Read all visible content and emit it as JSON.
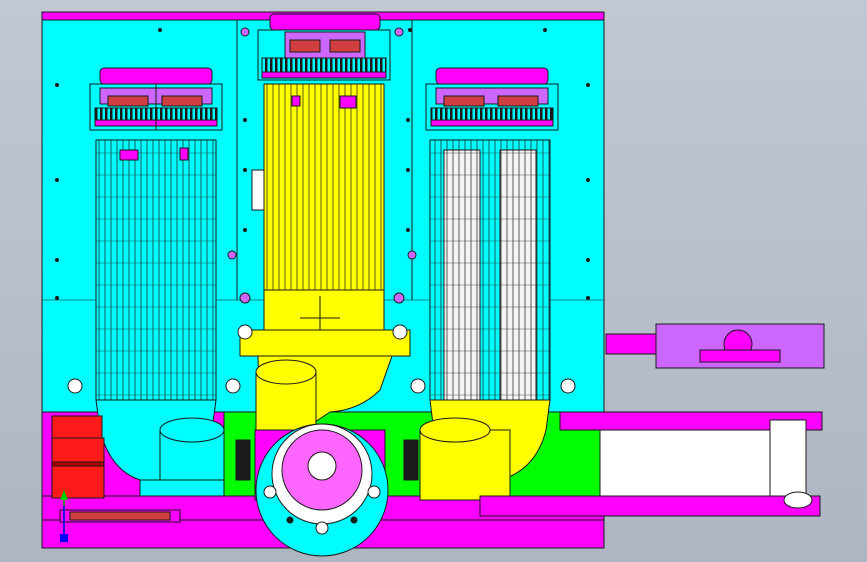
{
  "viewport": {
    "background_top": "#c2c8d2",
    "background_bottom": "#aeb6c4"
  },
  "colors": {
    "frame_cyan": "#00fdfd",
    "frame_magenta": "#ff00ff",
    "housing_yellow": "#ffff00",
    "base_green": "#00ff00",
    "motor_white": "#f4f4f4",
    "motor_red": "#ff1a1a",
    "roller_white": "#ffffff",
    "gear_violet": "#cc66ff",
    "outline": "#1a1a1a"
  },
  "components": [
    {
      "name": "left-motor",
      "color": "cyan"
    },
    {
      "name": "center-motor",
      "color": "yellow"
    },
    {
      "name": "right-motor",
      "color": "white"
    },
    {
      "name": "red-motor",
      "color": "red"
    },
    {
      "name": "side-cylinder",
      "color": "magenta"
    },
    {
      "name": "conveyor-belt",
      "color": "white"
    }
  ],
  "triad": {
    "axes": [
      "x",
      "y",
      "z"
    ]
  }
}
